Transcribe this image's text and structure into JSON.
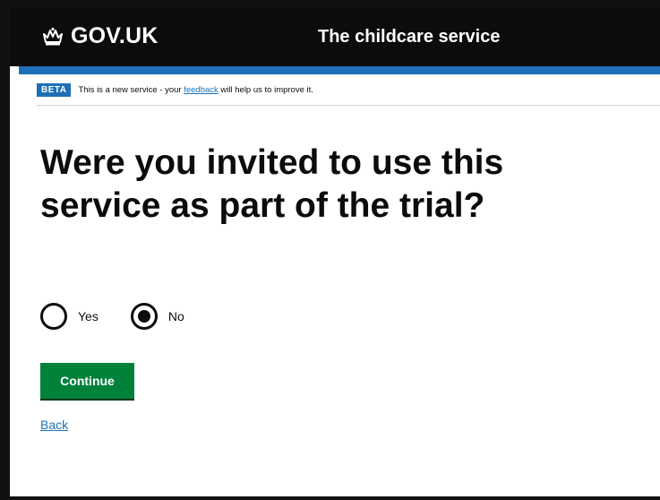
{
  "header": {
    "logo_text": "GOV.UK",
    "logo_icon": "crown-icon",
    "service_name": "The childcare service"
  },
  "phase_banner": {
    "tag": "BETA",
    "text_before": "This is a new service - your ",
    "link_text": "feedback",
    "text_after": " will help us to improve it."
  },
  "main": {
    "question": "Were you invited to use this service as part of the trial?",
    "options": [
      {
        "label": "Yes",
        "selected": false
      },
      {
        "label": "No",
        "selected": true
      }
    ],
    "continue_label": "Continue",
    "back_label": "Back"
  },
  "colors": {
    "header_bg": "#0b0c0c",
    "brand_blue": "#1d70b8",
    "button_green": "#00823b",
    "link_blue": "#1d70b8"
  }
}
